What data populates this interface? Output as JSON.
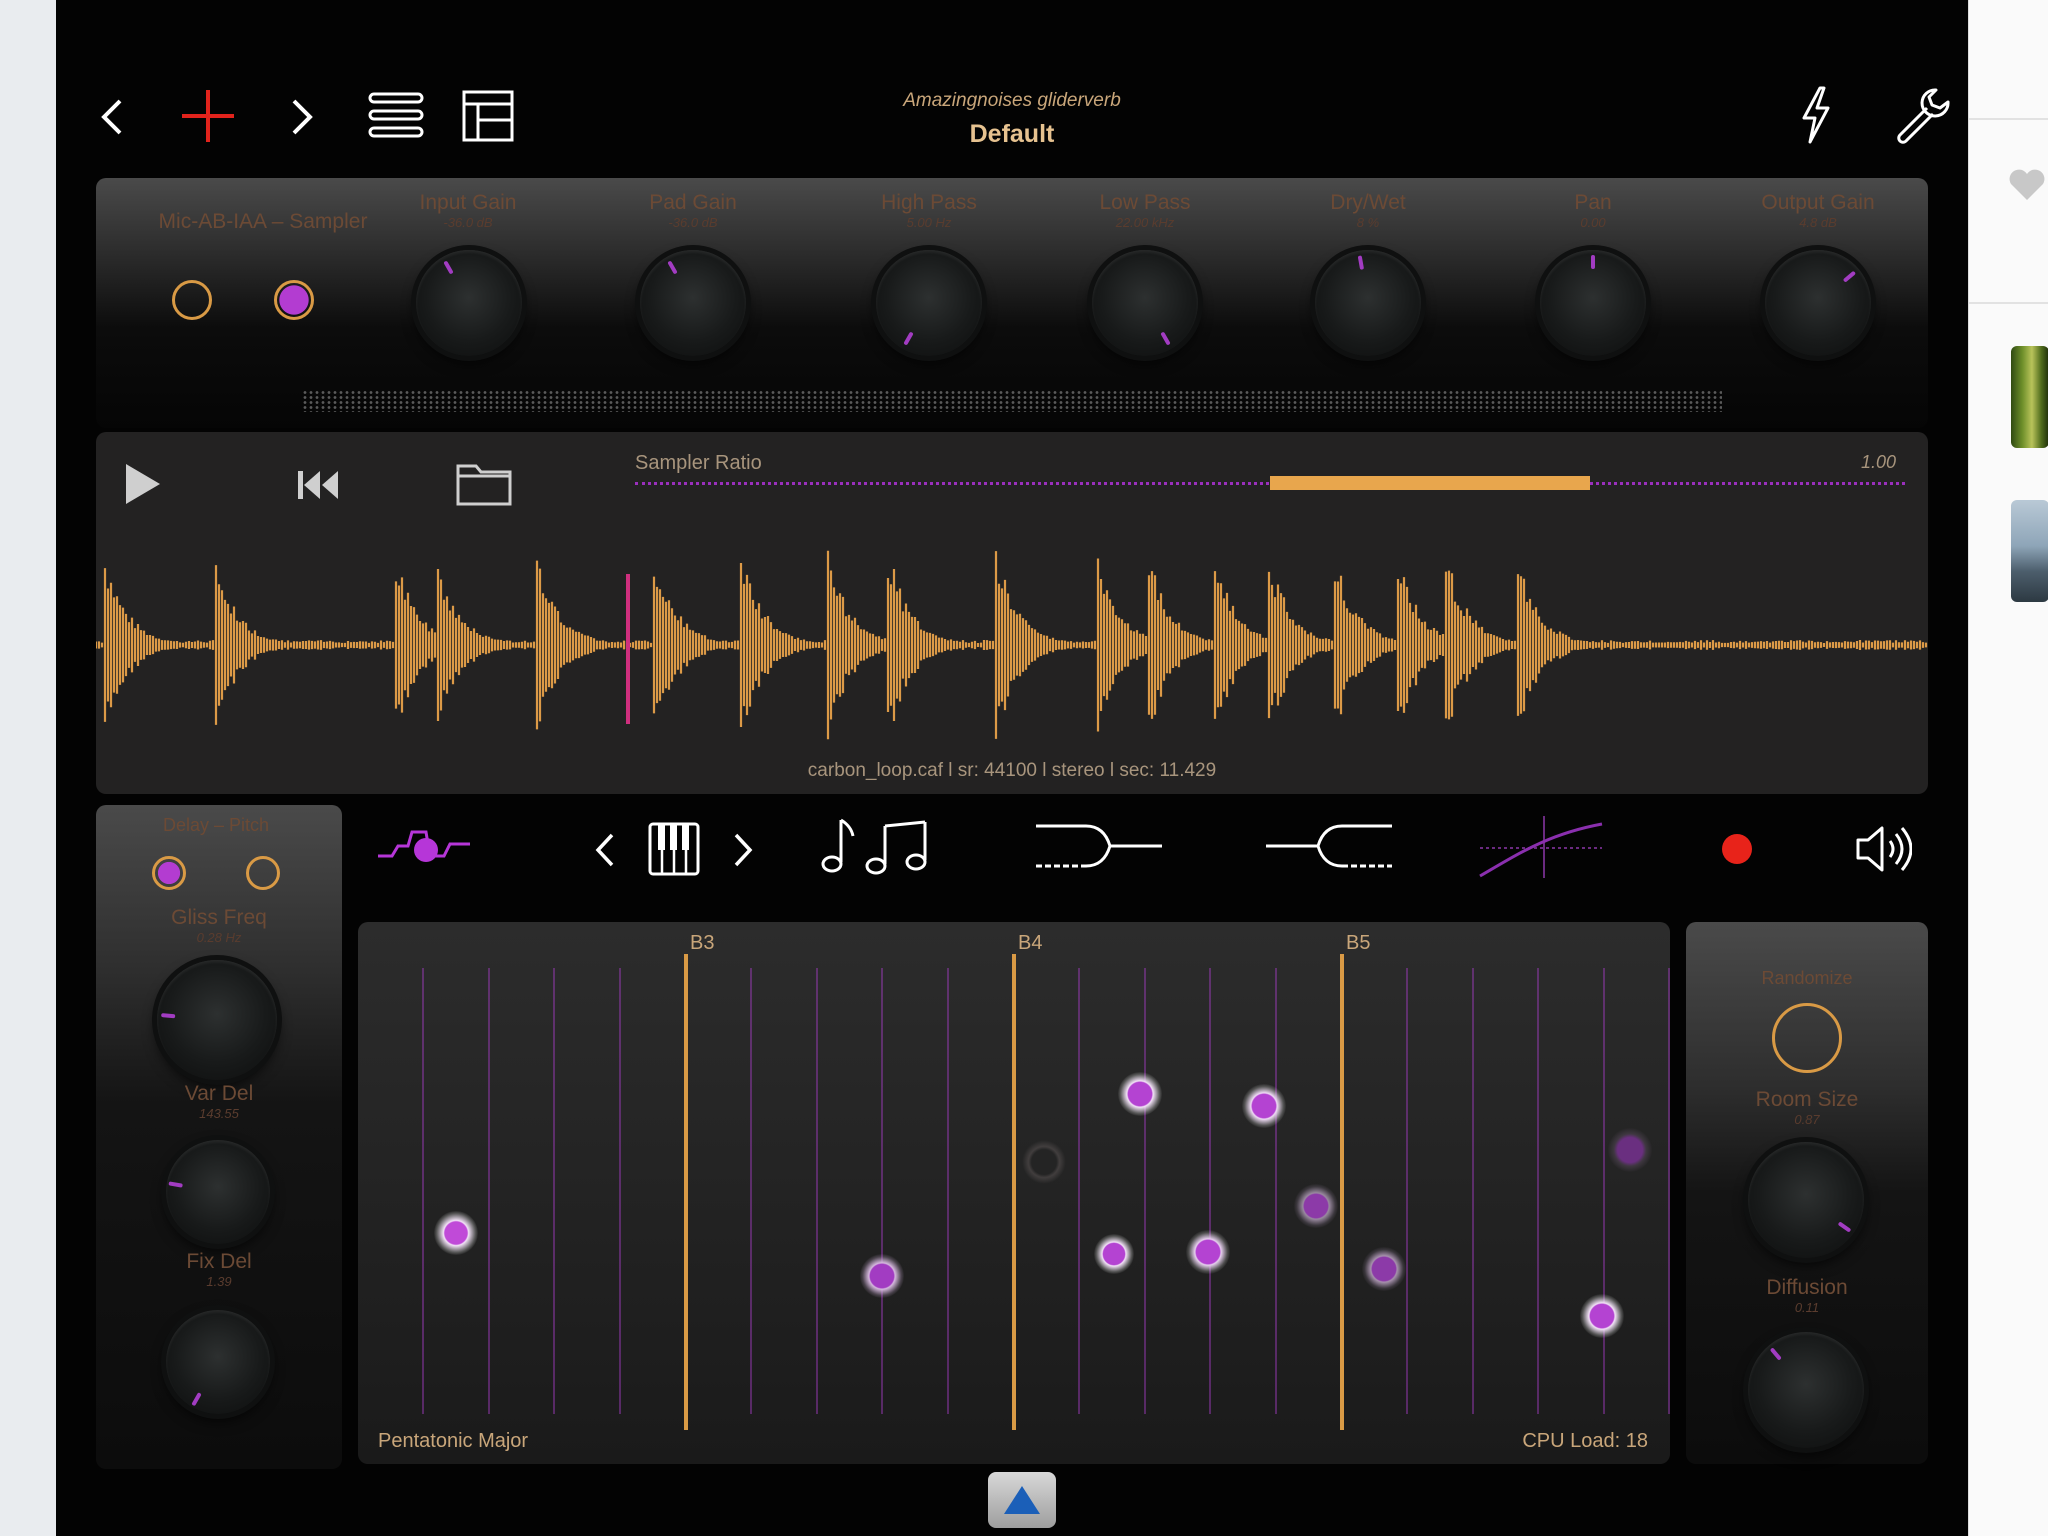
{
  "header": {
    "plugin_name": "Amazingnoises gliderverb",
    "preset_name": "Default"
  },
  "top_panel": {
    "source_label": "Mic-AB-IAA – Sampler",
    "knobs": [
      {
        "label": "Input Gain",
        "value": "-36.0 dB"
      },
      {
        "label": "Pad Gain",
        "value": "-36.0 dB"
      },
      {
        "label": "High Pass",
        "value": "5.00 Hz"
      },
      {
        "label": "Low Pass",
        "value": "22.00 kHz"
      },
      {
        "label": "Dry/Wet",
        "value": "8 %"
      },
      {
        "label": "Pan",
        "value": "0.00"
      },
      {
        "label": "Output Gain",
        "value": "4.8 dB"
      }
    ]
  },
  "sampler": {
    "ratio_label": "Sampler Ratio",
    "ratio_value": "1.00",
    "ratio_fill": 0.5,
    "file_info": "carbon_loop.caf l sr: 44100 l stereo l sec: 11.429"
  },
  "left_panel": {
    "title": "Delay – Pitch",
    "knobs": [
      {
        "label": "Gliss Freq",
        "value": "0.28 Hz"
      },
      {
        "label": "Var Del",
        "value": "143.55"
      },
      {
        "label": "Fix Del",
        "value": "1.39"
      }
    ]
  },
  "grid": {
    "markers": [
      "B3",
      "B4",
      "B5"
    ],
    "scale_label": "Pentatonic Major",
    "cpu_label": "CPU Load: 18"
  },
  "right_panel": {
    "randomize_label": "Randomize",
    "knobs": [
      {
        "label": "Room Size",
        "value": "0.87"
      },
      {
        "label": "Diffusion",
        "value": "0.11"
      }
    ]
  },
  "colors": {
    "accent_orange": "#d99a45",
    "accent_purple": "#a23cc2",
    "record_red": "#e8231a",
    "add_red": "#e2231c"
  }
}
